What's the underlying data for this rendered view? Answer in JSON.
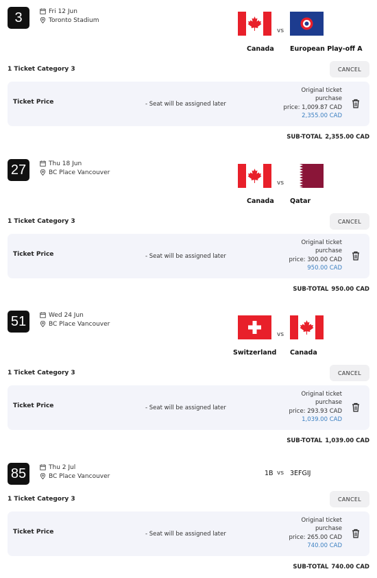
{
  "matches": [
    {
      "number": "3",
      "date": "Fri 12 Jun",
      "venue": "Toronto Stadium",
      "home": {
        "name": "Canada",
        "flag": "canada-flag"
      },
      "vs": "vs",
      "away": {
        "name": "European Play-off A",
        "flag": "uefa-flag"
      },
      "category": "1 Ticket Category 3",
      "cancel_label": "CANCEL",
      "ticket_price_label": "Ticket Price",
      "seat_note": "- Seat will be assigned later",
      "original_line1": "Original ticket",
      "original_line2": "purchase",
      "original_line3": "price: 1,009.87 CAD",
      "paid_price": "2,355.00 CAD",
      "subtotal_label": "SUB-TOTAL",
      "subtotal_value": "2,355.00 CAD"
    },
    {
      "number": "27",
      "date": "Thu 18 Jun",
      "venue": "BC Place Vancouver",
      "home": {
        "name": "Canada",
        "flag": "canada-flag"
      },
      "vs": "vs",
      "away": {
        "name": "Qatar",
        "flag": "qatar-flag"
      },
      "category": "1 Ticket Category 3",
      "cancel_label": "CANCEL",
      "ticket_price_label": "Ticket Price",
      "seat_note": "- Seat will be assigned later",
      "original_line1": "Original ticket",
      "original_line2": "purchase",
      "original_line3": "price: 300.00 CAD",
      "paid_price": "950.00 CAD",
      "subtotal_label": "SUB-TOTAL",
      "subtotal_value": "950.00 CAD"
    },
    {
      "number": "51",
      "date": "Wed 24 Jun",
      "venue": "BC Place Vancouver",
      "home": {
        "name": "Switzerland",
        "flag": "switzerland-flag"
      },
      "vs": "vs",
      "away": {
        "name": "Canada",
        "flag": "canada-flag"
      },
      "category": "1 Ticket Category 3",
      "cancel_label": "CANCEL",
      "ticket_price_label": "Ticket Price",
      "seat_note": "- Seat will be assigned later",
      "original_line1": "Original ticket",
      "original_line2": "purchase",
      "original_line3": "price: 293.93 CAD",
      "paid_price": "1,039.00 CAD",
      "subtotal_label": "SUB-TOTAL",
      "subtotal_value": "1,039.00 CAD"
    },
    {
      "number": "85",
      "date": "Thu 2 Jul",
      "venue": "BC Place Vancouver",
      "home": {
        "name": "1B"
      },
      "vs": "vs",
      "away": {
        "name": "3EFGIJ"
      },
      "category": "1 Ticket Category 3",
      "cancel_label": "CANCEL",
      "ticket_price_label": "Ticket Price",
      "seat_note": "- Seat will be assigned later",
      "original_line1": "Original ticket",
      "original_line2": "purchase",
      "original_line3": "price: 265.00 CAD",
      "paid_price": "740.00 CAD",
      "subtotal_label": "SUB-TOTAL",
      "subtotal_value": "740.00 CAD"
    }
  ],
  "colors": {
    "canada_red": "#e8202a",
    "qatar_maroon": "#8a1538",
    "uefa_blue": "#1d3c8f",
    "swiss_red": "#e8202a",
    "paid_price_blue": "#3a7fc1",
    "card_bg": "#f3f4fa"
  }
}
